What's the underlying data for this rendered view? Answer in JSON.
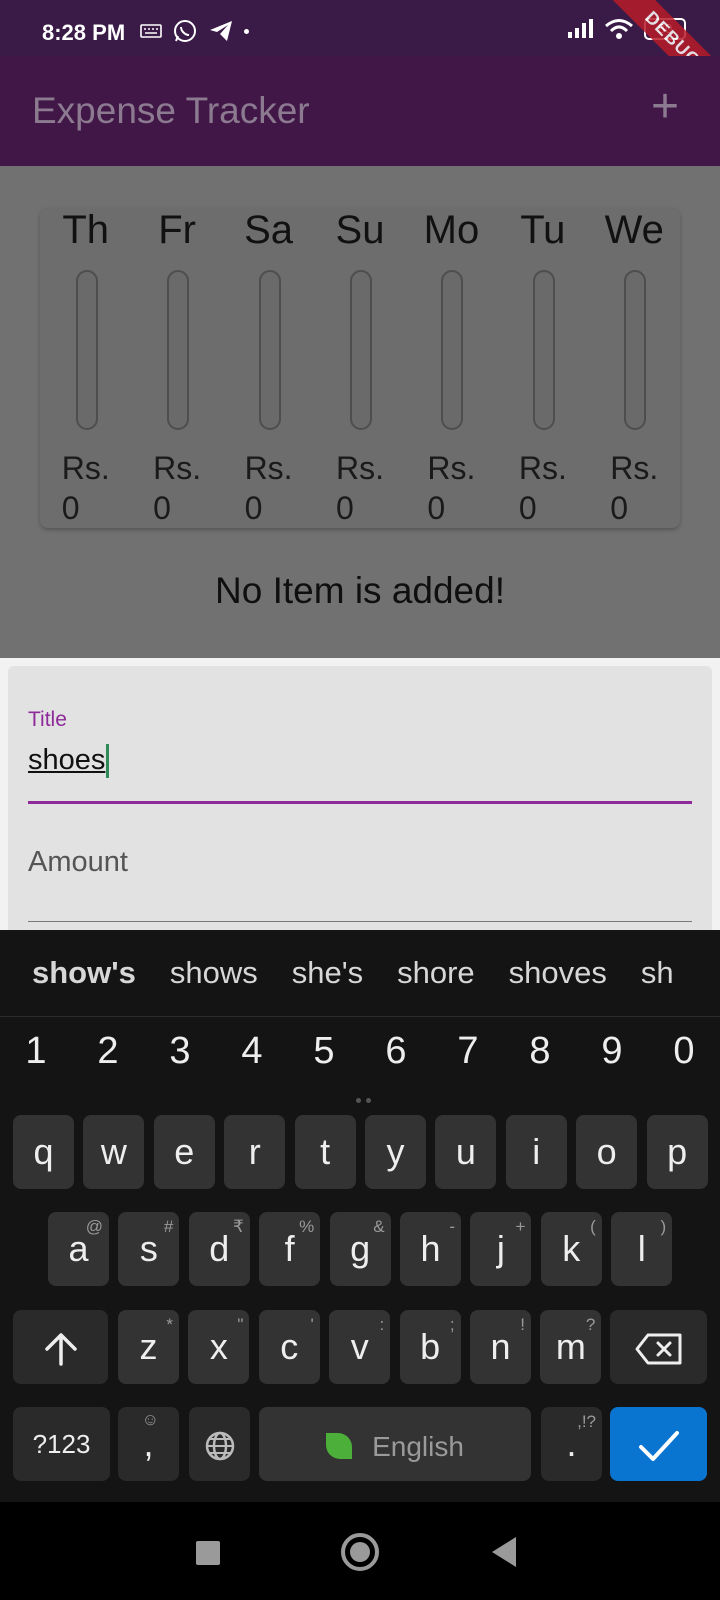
{
  "status_bar": {
    "time": "8:28 PM",
    "battery": "80",
    "debug_label": "DEBUG",
    "icons_left": [
      "keyboard-icon",
      "whatsapp-icon",
      "telegram-icon",
      "dot-icon"
    ],
    "icons_right": [
      "signal-icon",
      "wifi-icon",
      "battery-icon"
    ]
  },
  "app_bar": {
    "title": "Expense Tracker",
    "add_label": "+"
  },
  "chart": {
    "currency": "Rs.",
    "days": [
      {
        "label": "Th",
        "amount": "0",
        "fill": 0
      },
      {
        "label": "Fr",
        "amount": "0",
        "fill": 0
      },
      {
        "label": "Sa",
        "amount": "0",
        "fill": 0
      },
      {
        "label": "Su",
        "amount": "0",
        "fill": 0
      },
      {
        "label": "Mo",
        "amount": "0",
        "fill": 0
      },
      {
        "label": "Tu",
        "amount": "0",
        "fill": 0
      },
      {
        "label": "We",
        "amount": "0",
        "fill": 0
      }
    ]
  },
  "empty_message": "No Item is added!",
  "form": {
    "title_label": "Title",
    "title_value": "shoes",
    "amount_placeholder": "Amount"
  },
  "keyboard": {
    "suggestions": [
      "show's",
      "shows",
      "she's",
      "shore",
      "shoves",
      "sh"
    ],
    "numbers": [
      "1",
      "2",
      "3",
      "4",
      "5",
      "6",
      "7",
      "8",
      "9",
      "0"
    ],
    "row1": [
      "q",
      "w",
      "e",
      "r",
      "t",
      "y",
      "u",
      "i",
      "o",
      "p"
    ],
    "row2": [
      {
        "key": "a",
        "alt": "@"
      },
      {
        "key": "s",
        "alt": "#"
      },
      {
        "key": "d",
        "alt": "₹"
      },
      {
        "key": "f",
        "alt": "%"
      },
      {
        "key": "g",
        "alt": "&"
      },
      {
        "key": "h",
        "alt": "-"
      },
      {
        "key": "j",
        "alt": "+"
      },
      {
        "key": "k",
        "alt": "("
      },
      {
        "key": "l",
        "alt": ")"
      }
    ],
    "row3": [
      {
        "key": "z",
        "alt": "*"
      },
      {
        "key": "x",
        "alt": "\""
      },
      {
        "key": "c",
        "alt": "'"
      },
      {
        "key": "v",
        "alt": ":"
      },
      {
        "key": "b",
        "alt": ";"
      },
      {
        "key": "n",
        "alt": "!"
      },
      {
        "key": "m",
        "alt": "?"
      }
    ],
    "symbols_label": "?123",
    "emoji_comma": ",",
    "space_label": "English",
    "period_label": ".",
    "period_alt": ",!?"
  },
  "colors": {
    "primary": "#8e2a9a",
    "app_bar": "#401746",
    "action_key": "#0a74d1",
    "cursor": "#2e8b57"
  }
}
